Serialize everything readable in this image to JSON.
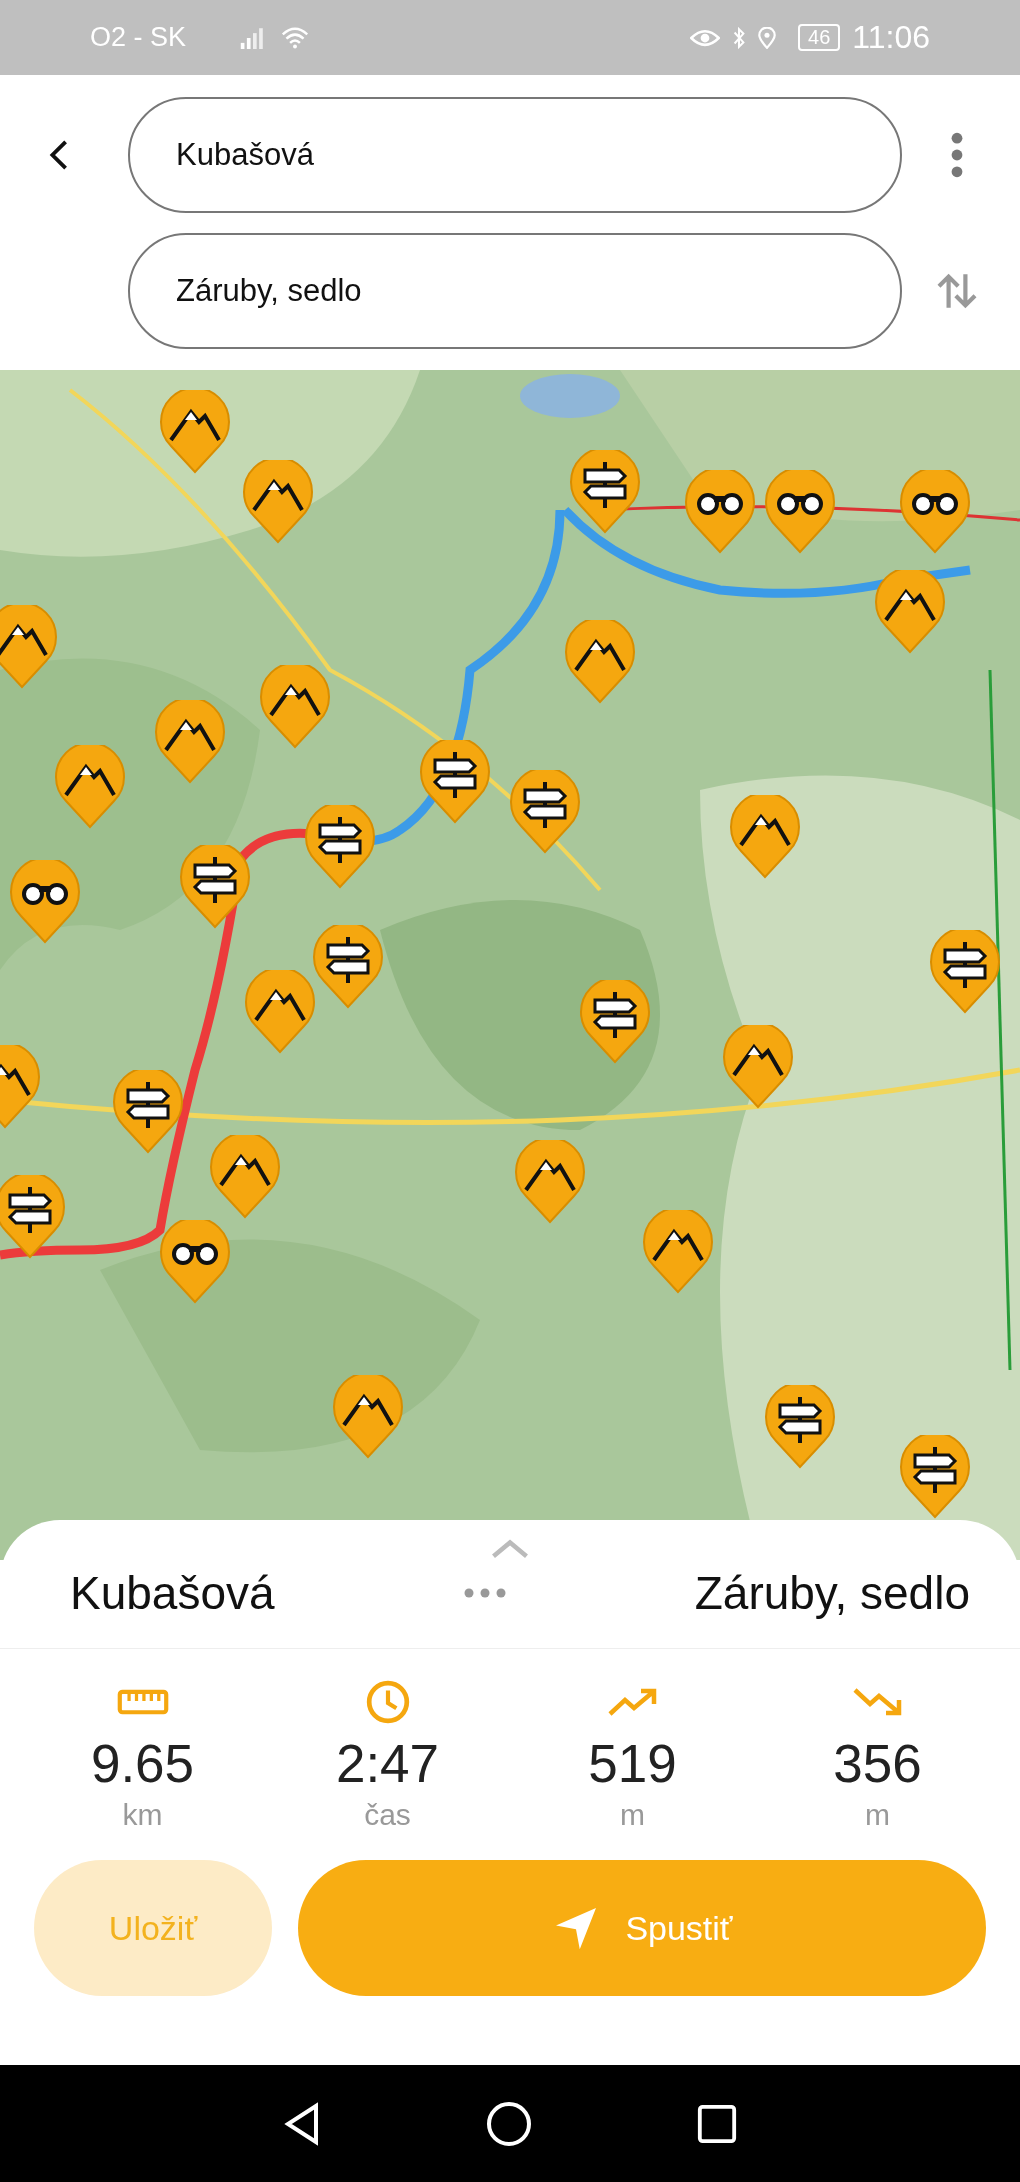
{
  "status_bar": {
    "carrier": "O2 - SK",
    "battery": "46",
    "time": "11:06"
  },
  "route_fields": [
    {
      "value": "Kubašová"
    },
    {
      "value": "Záruby, sedlo"
    }
  ],
  "summary": {
    "from": "Kubašová",
    "to": "Záruby, sedlo"
  },
  "stats": [
    {
      "kind": "distance",
      "value": "9.65",
      "unit": "km"
    },
    {
      "kind": "time",
      "value": "2:47",
      "unit": "čas"
    },
    {
      "kind": "ascent",
      "value": "519",
      "unit": "m"
    },
    {
      "kind": "descent",
      "value": "356",
      "unit": "m"
    }
  ],
  "buttons": [
    {
      "kind": "secondary",
      "label": "Uložiť"
    },
    {
      "kind": "primary",
      "label": "Spustiť"
    }
  ]
}
